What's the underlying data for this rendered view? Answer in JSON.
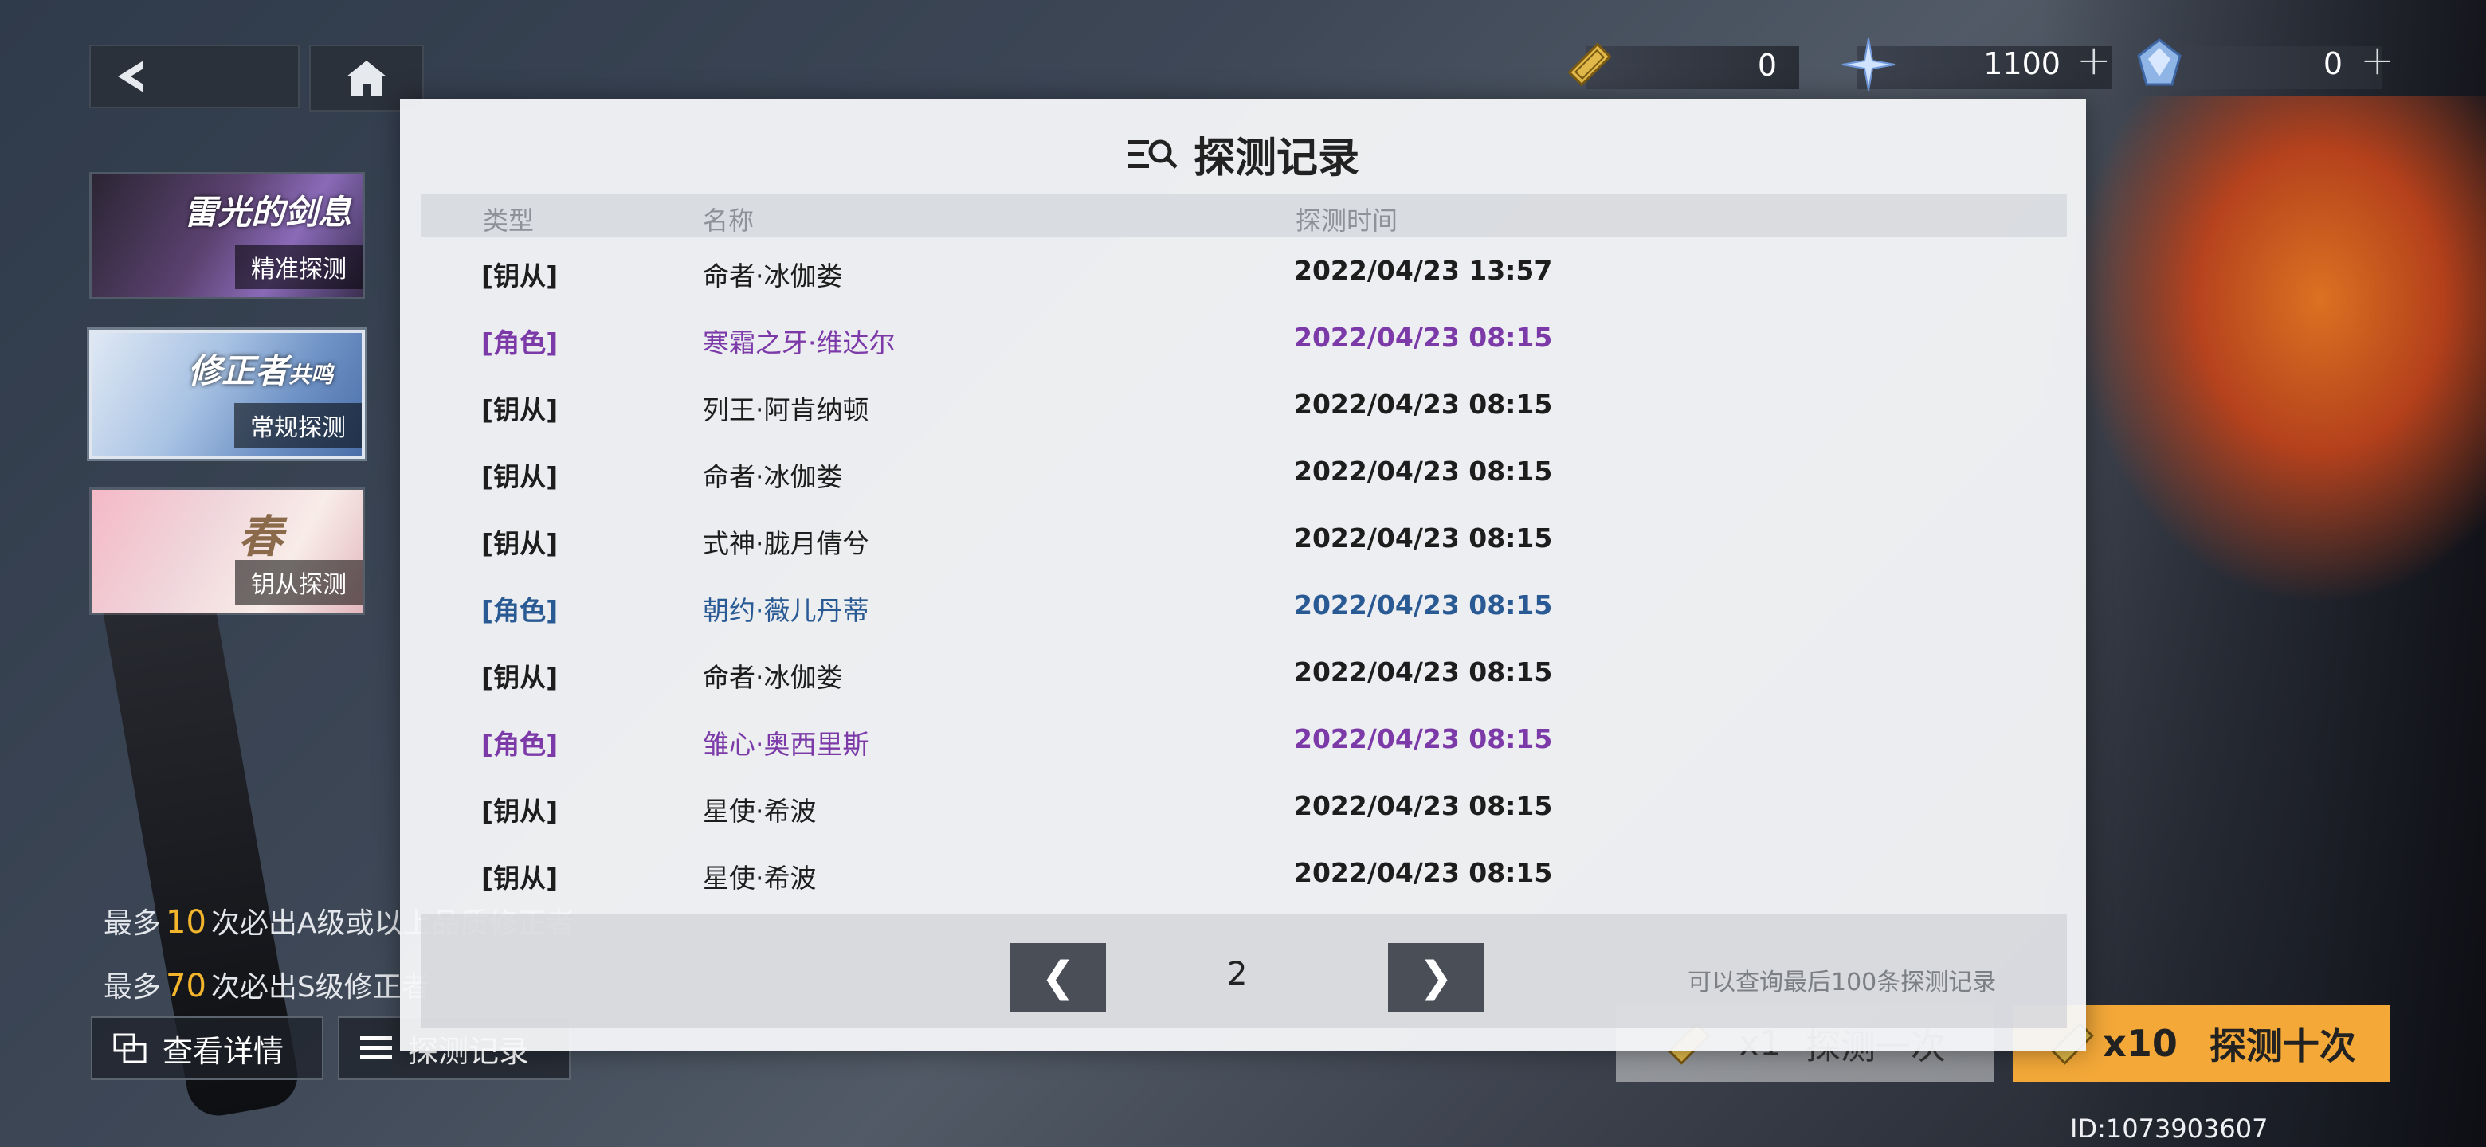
{
  "top": {
    "currencies": [
      {
        "icon": "ticket-icon",
        "value": "0",
        "has_plus": false
      },
      {
        "icon": "crystal-star-icon",
        "value": "1100",
        "has_plus": true
      },
      {
        "icon": "blue-gem-icon",
        "value": "0",
        "has_plus": true
      }
    ],
    "plus_label": "+"
  },
  "banners": [
    {
      "title": "雷光的剑息",
      "subtitle": "精准探测",
      "active": false
    },
    {
      "title": "修正者",
      "title_suffix": "共鸣",
      "subtitle": "常规探测",
      "active": true
    },
    {
      "title": "春",
      "subtitle": "钥从探测",
      "active": false
    }
  ],
  "rules": [
    {
      "prefix": "最多",
      "num": "10",
      "suffix": "次必出A级或以上品质修正者"
    },
    {
      "prefix": "最多",
      "num": "70",
      "suffix": "次必出S级修正者"
    }
  ],
  "bottom_buttons": {
    "details": "查看详情",
    "records": "探测记录"
  },
  "draw": {
    "single_count": "x1",
    "single_label": "探测一次",
    "ten_count": "x10",
    "ten_label": "探测十次"
  },
  "uid": "ID:1073903607",
  "modal": {
    "title": "探测记录",
    "headers": {
      "type": "类型",
      "name": "名称",
      "time": "探测时间"
    },
    "rows": [
      {
        "type": "[钥从]",
        "name": "命者·冰伽娄",
        "time": "2022/04/23 13:57",
        "tone": "normal"
      },
      {
        "type": "[角色]",
        "name": "寒霜之牙·维达尔",
        "time": "2022/04/23 08:15",
        "tone": "purple"
      },
      {
        "type": "[钥从]",
        "name": "列王·阿肯纳顿",
        "time": "2022/04/23 08:15",
        "tone": "normal"
      },
      {
        "type": "[钥从]",
        "name": "命者·冰伽娄",
        "time": "2022/04/23 08:15",
        "tone": "normal"
      },
      {
        "type": "[钥从]",
        "name": "式神·胧月倩兮",
        "time": "2022/04/23 08:15",
        "tone": "normal"
      },
      {
        "type": "[角色]",
        "name": "朝约·薇儿丹蒂",
        "time": "2022/04/23 08:15",
        "tone": "blue"
      },
      {
        "type": "[钥从]",
        "name": "命者·冰伽娄",
        "time": "2022/04/23 08:15",
        "tone": "normal"
      },
      {
        "type": "[角色]",
        "name": "雏心·奥西里斯",
        "time": "2022/04/23 08:15",
        "tone": "purple"
      },
      {
        "type": "[钥从]",
        "name": "星使·希波",
        "time": "2022/04/23 08:15",
        "tone": "normal"
      },
      {
        "type": "[钥从]",
        "name": "星使·希波",
        "time": "2022/04/23 08:15",
        "tone": "normal"
      }
    ],
    "page": "2",
    "prev_label": "❮",
    "next_label": "❯",
    "note": "可以查询最后100条探测记录"
  }
}
